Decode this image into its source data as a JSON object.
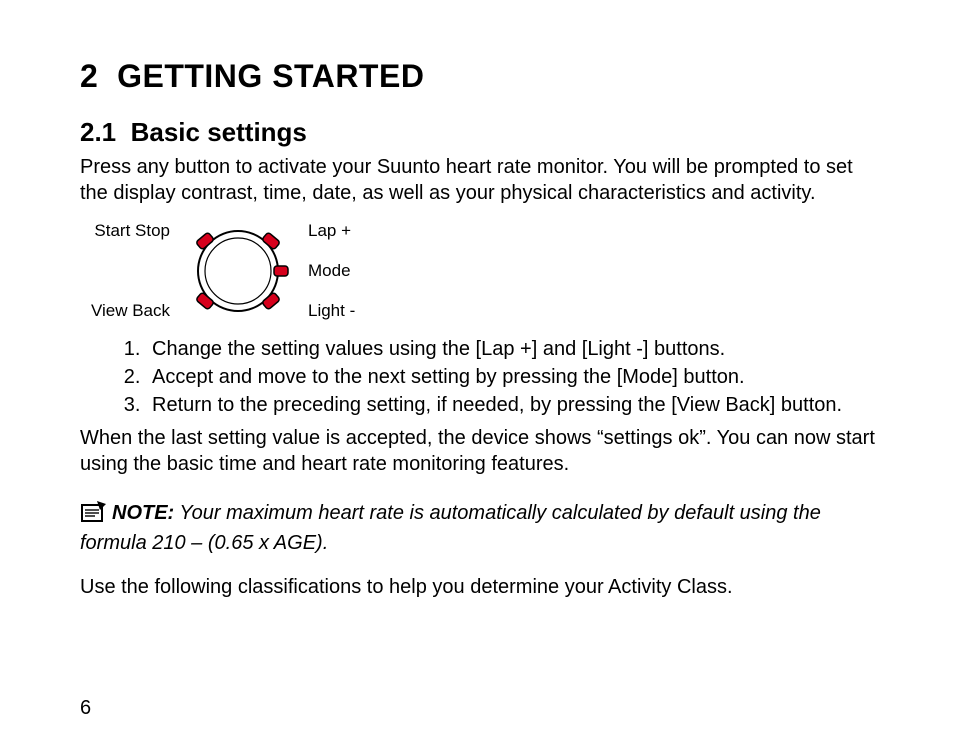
{
  "chapter": {
    "number": "2",
    "title": "GETTING STARTED"
  },
  "section": {
    "number": "2.1",
    "title": "Basic settings"
  },
  "intro": "Press any button to activate your Suunto heart rate monitor. You will be prompted to set the display contrast, time, date, as well as your physical characteristics and activity.",
  "diagram": {
    "top_left": "Start Stop",
    "bottom_left": "View Back",
    "top_right": "Lap +",
    "mid_right": "Mode",
    "bottom_right": "Light -"
  },
  "steps": [
    "Change the setting values using the [Lap +] and [Light -] buttons.",
    "Accept and move to the next setting by pressing the [Mode] button.",
    "Return to the preceding setting, if needed, by pressing the [View Back] button."
  ],
  "after_steps": "When the last setting value is accepted, the device shows “settings ok”. You can now start using the basic time and heart rate monitoring features.",
  "note": {
    "label": "NOTE:",
    "text": " Your maximum heart rate is automatically calculated by default using the formula 210 – (0.65 x AGE)."
  },
  "closing": "Use the following classifications to help you determine your Activity Class.",
  "page_number": "6"
}
